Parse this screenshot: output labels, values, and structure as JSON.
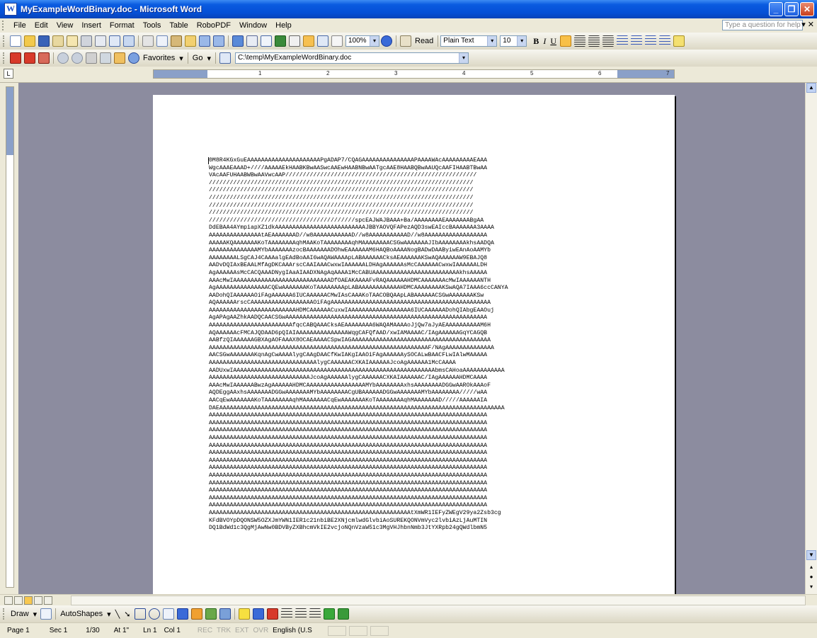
{
  "window": {
    "title": "MyExampleWordBinary.doc - Microsoft Word"
  },
  "menubar": {
    "items": [
      "File",
      "Edit",
      "View",
      "Insert",
      "Format",
      "Tools",
      "Table",
      "RoboPDF",
      "Window",
      "Help"
    ],
    "help_placeholder": "Type a question for help"
  },
  "toolbar1": {
    "zoom": "100%",
    "read_label": "Read",
    "style": "Plain Text",
    "font_size": "10"
  },
  "toolbar2": {
    "favorites": "Favorites",
    "go": "Go",
    "address": "C:\\temp\\MyExampleWordBinary.doc"
  },
  "ruler": {
    "numbers": [
      "1",
      "2",
      "3",
      "4",
      "5",
      "6",
      "7"
    ]
  },
  "document": {
    "lines": [
      "0M8R4KGxGuEAAAAAAAAAAAAAAAAAAAAAPgADAP7/CQAGAAAAAAAAAAAAAAAPAAAAWAcAAAAAAAAAEAAA",
      "WgcAAAEAAAD+////AAAAAEkHAABKBwAASwcAAEwHAABNBwAATgcAAE8HAABQBwAAUQcAAFIHAABTBwAA",
      "VAcAAFUHAABWBwAAVwcAAP///////////////////////////////////////////////////////",
      "////////////////////////////////////////////////////////////////////////////",
      "////////////////////////////////////////////////////////////////////////////",
      "////////////////////////////////////////////////////////////////////////////",
      "////////////////////////////////////////////////////////////////////////////",
      "////////////////////////////////////////////////////////////////////////////",
      "//////////////////////////////////////////spcEAJWAJBAAA+Ba/AAAAAAAAEAAAAAAABgAA",
      "DdEBAA4AYmpiapXZ1dkAAAAAAAAAAAAAAAAAAAAAAAAAAJBBYAOVQFAPezAQD3swEAIccBAAAAAAA3AAAA",
      "AAAAAAAAAAAAAAAtAEAAAAAAAD//w8AAAAAAAAAAAD//w8AAAAAAAAAAAD//w8AAAAAAAAAAAAAAAAAA",
      "AAAAAKQAAAAAAAKoTAAAAAAAAqhMAAKoTAAAAAAAAqhMAAAAAAAACSGwAAAAAAAJIbAAAAAAAAkhsAADQA",
      "AAAAAAAAAAAAAAMYbAAAAAAAzocBAAAAAAADOhwEAAAAAAM6HAQBoAAAANogBADwDAAByiwEAnAoAAMYb",
      "AAAAAAAALSgCAJ4CAAAalgEAdBoAAI6wAQAWAAAApLABAAAAAACksAEAAAAAAKSwAQAAAAAAW9EBAJQ8",
      "AADvDQIAxBEAALMfAgDKCAAArscCAAIAAACwxwIAAAAAALDHAgAAAAAAsMcCAAAAAACwxwIAAAAAALDH",
      "AgAAAAAAsMcCACQAAADNygIAaAIAADXNAgAqAAAA1McCABUAAAAAAAAAAAAAAAAAAAAAAAAAkhsAAAAA",
      "AAAcMwIAAAAAAAAAAAAAAAAAAAAAAAAAAAADfOAEAKAAAAFvRAQAAAAAAHDMCAAAAAAAcMwIAAAAAANTH",
      "AgAAAAAAAAAAAAAAACQEwAAAAAAAKoTAAAAAAAApLABAAAAAAAAAAAAHDMCAAAAAAAAKSwAQA7IAAA6ccCANYA",
      "AADohQIAAAAAAOiFAgAAAAAA6IUCAAAAAACMwIAsCAAAKoTAACOBQAApLABAAAAAACSGwAAAAAAAKSw",
      "AQAAAAAArscCAAAAAAAAAAAAAAAAAAOiFAgAAAAAAAAAAAAAAAAAAAAAAAAAAAAAAAAAAAAAAAAAAAAAA",
      "AAAAAAAAAAAAAAAAAAAAAAAAAHDMCAAAAAACuxwIAAAAAAAAAAAAAAAAAA6IUCAAAAAADohQIAbgEAAOuj",
      "AgAPAgAAZhkAADQCAACSGwAAAAAAAAAAAAAAAAAAAAAAAAAAAAAAAAAAAAAAAAAAAAAAAAAAAAAAAAAA",
      "AAAAAAAAAAAAAAAAAAAAAAAAfqcCABQAAACksAEAAAAAAAA6WAQAMAAAAoJjQw7aJyAEAAAAAAAAAAM6H",
      "AQAAAAAAcFMCAJQDAAD6pQIAIAAAAAAAAAAAAAAAWqgCAFQfAAD/xwIAMAAAAC/IAgAAAAAAGqYCAGQB",
      "AABfzQIAAAAAAGBXAgAOFAAAX8OCAEAAAACSpwIAGAAAAAAAAAAAAAAAAAAAAAAAAAAAAAAAAAAAAAAAA",
      "AAAAAAAAAAAAAAAAAAAAAAAAAAAAAAAAAAAAAAAAAAAAAAAAAAAAAAAAAAAAAAAF/NAgAAAAAAAAAAAAAA",
      "AACSGwAAAAAAAKqnAgCwAAAAlygCAAgDAACfKwIAKgIAAOiFAgAAAAAAySOCALwBAACFLwIAlwMAAAAA",
      "AAAAAAAAAAAAAAAAAAAAAAAAAAAAAAAlygCAAAAAACXKAIAAAAAAJcoAgAAAAAA1McCAAAA",
      "AADUxwIAAAAAAAAAAAAAAAAAAAAAAAAAAAAAAAAAAAAAAAAAAAAAAAAAAAAAAAAAAbmsCAHoaAAAAAAAAAAAA",
      "AAAAAAAAAAAAAAAAAAAAAAAAAAAAAJcoAgAAAAAAlygCAAAAAACXKAIAAAAAAC/IAgAAAAAAHDMCAAAA",
      "AAAcMwIAAAAAABwzAgAAAAAAHDMCAAAAAAAAAAAAAAAAAMYbAAAAAAAAxhsAAAAAAAADGGwAAROkAAAoF",
      "AQDEggAAxhsAAAAAAADGGwAAAAAAAMYbAAAAAAAACgUBAAAAAADGGwAAAAAAAMYbAAAAAAAA/////wAA",
      "AACqEwAAAAAAAKoTAAAAAAAAqhMAAAAAAACqEwAAAAAAAKoTAAAAAAAAqhMAAAAAAAD/////AAAAAAIA",
      "DAEAAAAAAAAAAAAAAAAAAAAAAAAAAAAAAAAAAAAAAAAAAAAAAAAAAAAAAAAAAAAAAAAAAAAAAAAAAAAAAAAAA",
      "AAAAAAAAAAAAAAAAAAAAAAAAAAAAAAAAAAAAAAAAAAAAAAAAAAAAAAAAAAAAAAAAAAAAAAAAAAAAAAAA",
      "AAAAAAAAAAAAAAAAAAAAAAAAAAAAAAAAAAAAAAAAAAAAAAAAAAAAAAAAAAAAAAAAAAAAAAAAAAAAAAAA",
      "AAAAAAAAAAAAAAAAAAAAAAAAAAAAAAAAAAAAAAAAAAAAAAAAAAAAAAAAAAAAAAAAAAAAAAAAAAAAAAAA",
      "AAAAAAAAAAAAAAAAAAAAAAAAAAAAAAAAAAAAAAAAAAAAAAAAAAAAAAAAAAAAAAAAAAAAAAAAAAAAAAAA",
      "AAAAAAAAAAAAAAAAAAAAAAAAAAAAAAAAAAAAAAAAAAAAAAAAAAAAAAAAAAAAAAAAAAAAAAAAAAAAAAAA",
      "AAAAAAAAAAAAAAAAAAAAAAAAAAAAAAAAAAAAAAAAAAAAAAAAAAAAAAAAAAAAAAAAAAAAAAAAAAAAAAAA",
      "AAAAAAAAAAAAAAAAAAAAAAAAAAAAAAAAAAAAAAAAAAAAAAAAAAAAAAAAAAAAAAAAAAAAAAAAAAAAAAAA",
      "AAAAAAAAAAAAAAAAAAAAAAAAAAAAAAAAAAAAAAAAAAAAAAAAAAAAAAAAAAAAAAAAAAAAAAAAAAAAAAAA",
      "AAAAAAAAAAAAAAAAAAAAAAAAAAAAAAAAAAAAAAAAAAAAAAAAAAAAAAAAAAAAAAAAAAAAAAAAAAAAAAAA",
      "AAAAAAAAAAAAAAAAAAAAAAAAAAAAAAAAAAAAAAAAAAAAAAAAAAAAAAAAAAAAAAAAAAAAAAAAAAAAAAAA",
      "AAAAAAAAAAAAAAAAAAAAAAAAAAAAAAAAAAAAAAAAAAAAAAAAAAAAAAAAAAAAAAAAAAAAAAAAAAAAAAAA",
      "AAAAAAAAAAAAAAAAAAAAAAAAAAAAAAAAAAAAAAAAAAAAAAAAAAAAAAAAAAAAAAAAAAAAAAAAAAAAAAAA",
      "AAAAAAAAAAAAAAAAAAAAAAAAAAAAAAAAAAAAAAAAAAAAAAAAAAAAAAAAAAAAAAAAAAAAAAAAAAAAAAAA",
      "AAAAAAAAAAAAAAAAAAAAAAAAAAAAAAAAAAAAAAAAAAAAAAAAAAAAAAAAAAtXmWR1IEFyZWEgV29ya2Zsb3cg",
      "KFdBVOYpDQONSW5OZXJmYWN1IER1c21nbiBE2XNjcmlwdGlvbiAoSUREKQONVmVyc2lvbiAzLjAuMTIN",
      "DQ1BdWd1c3QgMjAwNw0BDVByZXBhcmVkIE2vcjoNQnVzaW51c3MgVHJhbnNmb3JtYXRpb24gQWdlbmN5"
    ]
  },
  "drawbar": {
    "draw_label": "Draw",
    "autoshapes_label": "AutoShapes"
  },
  "statusbar": {
    "page": "Page 1",
    "sec": "Sec 1",
    "pages": "1/30",
    "at": "At 1\"",
    "ln": "Ln 1",
    "col": "Col 1",
    "rec": "REC",
    "trk": "TRK",
    "ext": "EXT",
    "ovr": "OVR",
    "language": "English (U.S"
  }
}
